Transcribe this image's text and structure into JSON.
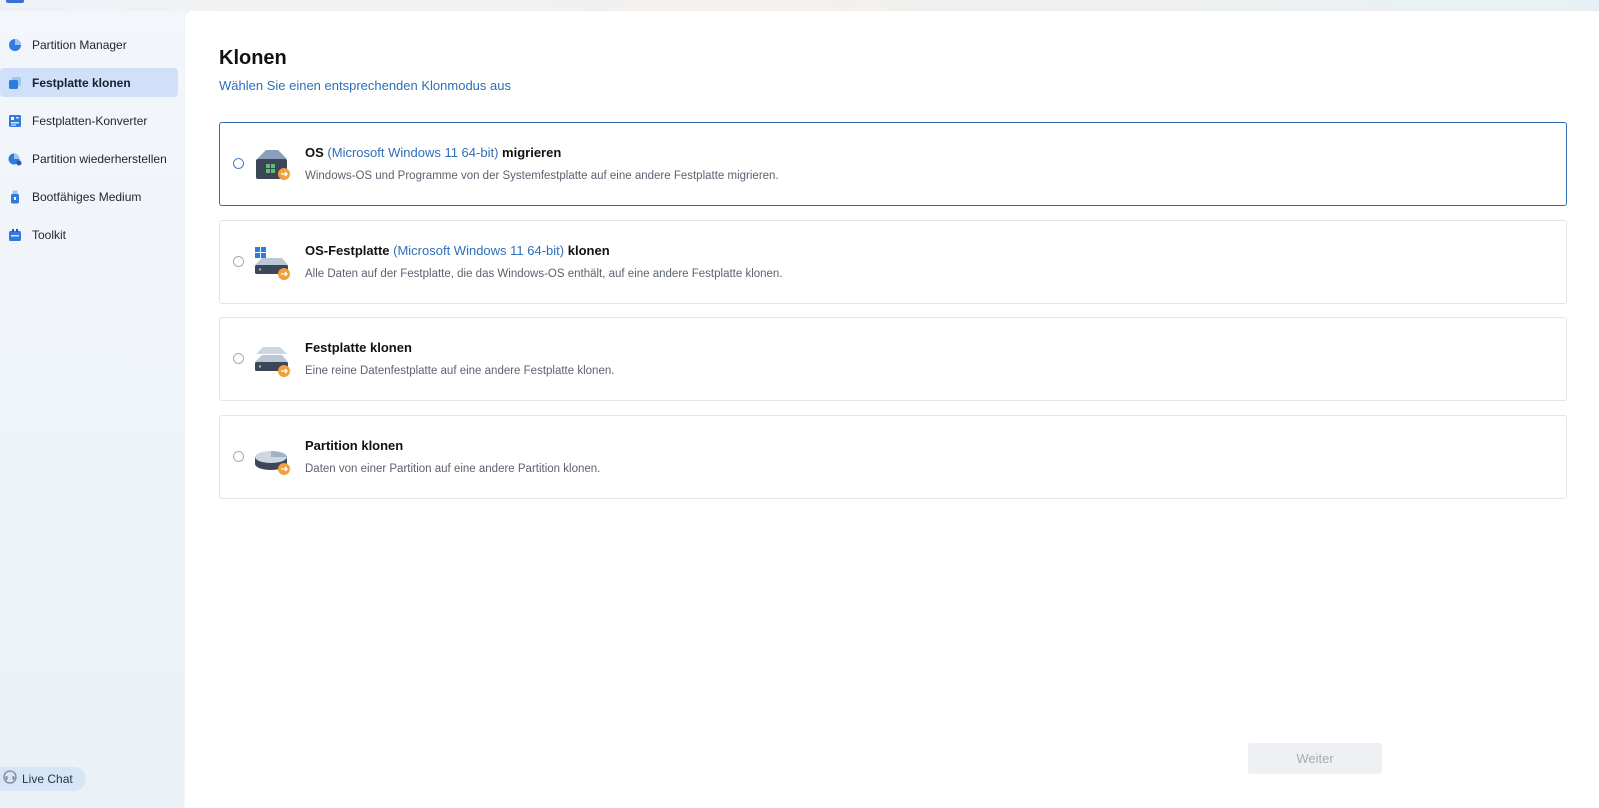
{
  "sidebar": {
    "items": [
      {
        "label": "Partition Manager",
        "icon": "pie-chart-icon",
        "active": false
      },
      {
        "label": "Festplatte klonen",
        "icon": "clone-disk-icon",
        "active": true
      },
      {
        "label": "Festplatten-Konverter",
        "icon": "converter-icon",
        "active": false
      },
      {
        "label": "Partition wiederherstellen",
        "icon": "recovery-icon",
        "active": false
      },
      {
        "label": "Bootfähiges Medium",
        "icon": "usb-drive-icon",
        "active": false
      },
      {
        "label": "Toolkit",
        "icon": "toolkit-icon",
        "active": false
      }
    ],
    "live_chat": "Live Chat"
  },
  "main": {
    "title": "Klonen",
    "subtitle": "Wählen Sie einen entsprechenden Klonmodus aus",
    "options": [
      {
        "title_pre": "OS",
        "title_accent": "(Microsoft Windows 11 64-bit)",
        "title_post": "migrieren",
        "description": "Windows-OS und Programme von der Systemfestplatte auf eine andere Festplatte migrieren.",
        "icon": "os-migrate-icon",
        "selected": true
      },
      {
        "title_pre": "OS-Festplatte",
        "title_accent": "(Microsoft Windows 11 64-bit)",
        "title_post": "klonen",
        "description": "Alle Daten auf der Festplatte, die das Windows-OS enthält, auf eine andere Festplatte klonen.",
        "icon": "os-disk-clone-icon",
        "selected": false
      },
      {
        "title_pre": "Festplatte klonen",
        "title_accent": "",
        "title_post": "",
        "description": "Eine reine Datenfestplatte auf eine andere Festplatte klonen.",
        "icon": "disk-clone-icon",
        "selected": false
      },
      {
        "title_pre": "Partition klonen",
        "title_accent": "",
        "title_post": "",
        "description": "Daten von einer Partition auf eine andere Partition klonen.",
        "icon": "partition-clone-icon",
        "selected": false
      }
    ],
    "next_button": "Weiter"
  },
  "colors": {
    "accent": "#2e6fb8",
    "active_nav": "#cfe0f8",
    "badge_orange": "#f0a03c"
  }
}
